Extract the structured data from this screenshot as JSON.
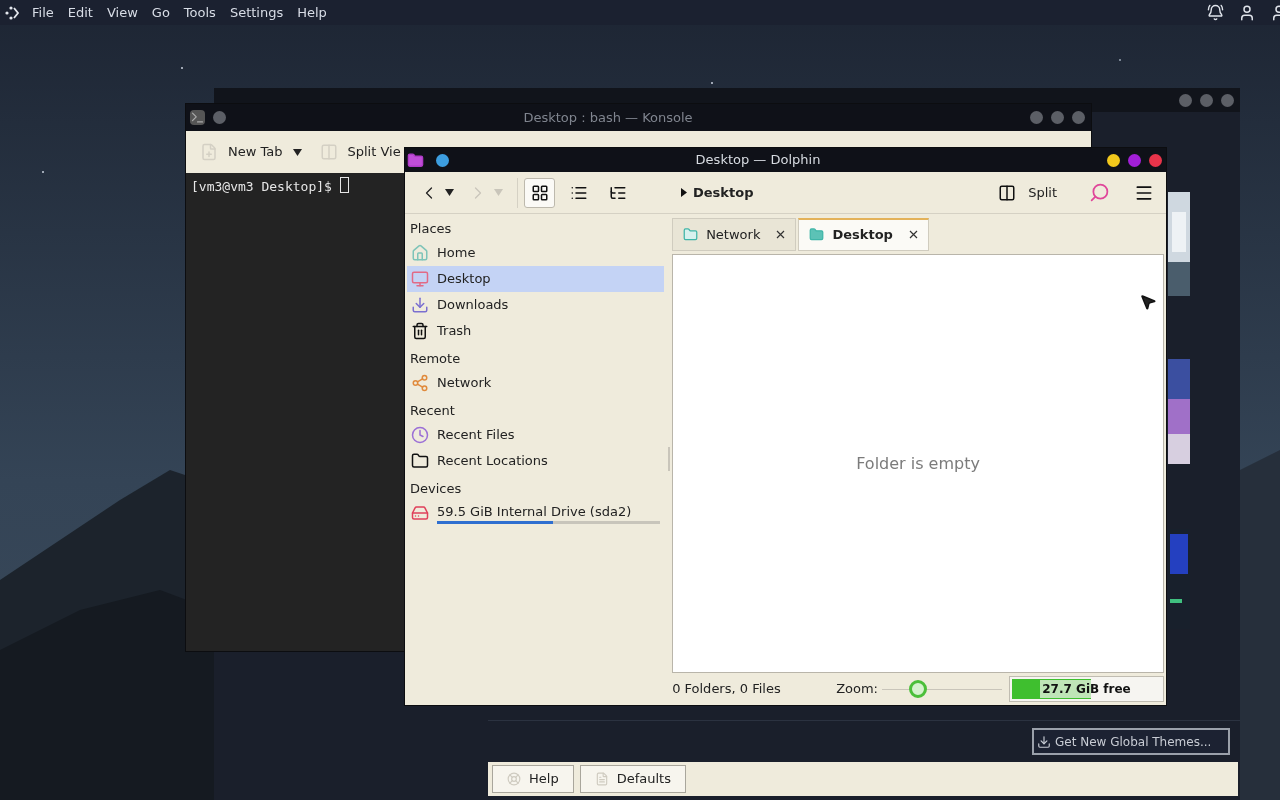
{
  "menubar": {
    "items": [
      "File",
      "Edit",
      "View",
      "Go",
      "Tools",
      "Settings",
      "Help"
    ]
  },
  "settings_window": {
    "get_new_button": "Get New Global Themes...",
    "footer_buttons": [
      {
        "label": "Help",
        "kind": "help"
      },
      {
        "label": "Defaults",
        "kind": "defaults"
      }
    ]
  },
  "konsole": {
    "title": "Desktop : bash — Konsole",
    "toolbar": [
      {
        "label": "New Tab",
        "kind": "new-tab"
      },
      {
        "label": "Split Vie",
        "kind": "split"
      }
    ],
    "prompt": "[vm3@vm3 Desktop]$"
  },
  "dolphin": {
    "title": "Desktop — Dolphin",
    "nav": [
      {
        "kind": "back",
        "disabled": false
      },
      {
        "kind": "forward",
        "disabled": true
      }
    ],
    "view_modes": [
      {
        "kind": "icons",
        "selected": true
      },
      {
        "kind": "compact",
        "selected": false
      },
      {
        "kind": "details",
        "selected": false
      }
    ],
    "breadcrumb": "Desktop",
    "split_label": "Split",
    "places": [
      {
        "heading": "Places",
        "items": [
          {
            "label": "Home",
            "kind": "home",
            "selected": false
          },
          {
            "label": "Desktop",
            "kind": "desktop",
            "selected": true
          },
          {
            "label": "Downloads",
            "kind": "downloads",
            "selected": false
          },
          {
            "label": "Trash",
            "kind": "trash",
            "selected": false
          }
        ]
      },
      {
        "heading": "Remote",
        "items": [
          {
            "label": "Network",
            "kind": "network",
            "selected": false
          }
        ]
      },
      {
        "heading": "Recent",
        "items": [
          {
            "label": "Recent Files",
            "kind": "recent-files",
            "selected": false
          },
          {
            "label": "Recent Locations",
            "kind": "recent-locations",
            "selected": false
          }
        ]
      },
      {
        "heading": "Devices",
        "items": [
          {
            "label": "59.5 GiB Internal Drive (sda2)",
            "kind": "drive",
            "selected": false,
            "level": 0.52
          }
        ]
      }
    ],
    "tabs": [
      {
        "label": "Network",
        "selected": false
      },
      {
        "label": "Desktop",
        "selected": true
      }
    ],
    "empty_message": "Folder is empty",
    "status": "0 Folders, 0 Files",
    "zoom": {
      "label": "Zoom:",
      "level": 0.3
    },
    "free_space": {
      "label": "27.7 GiB free",
      "level": 0.53
    }
  }
}
